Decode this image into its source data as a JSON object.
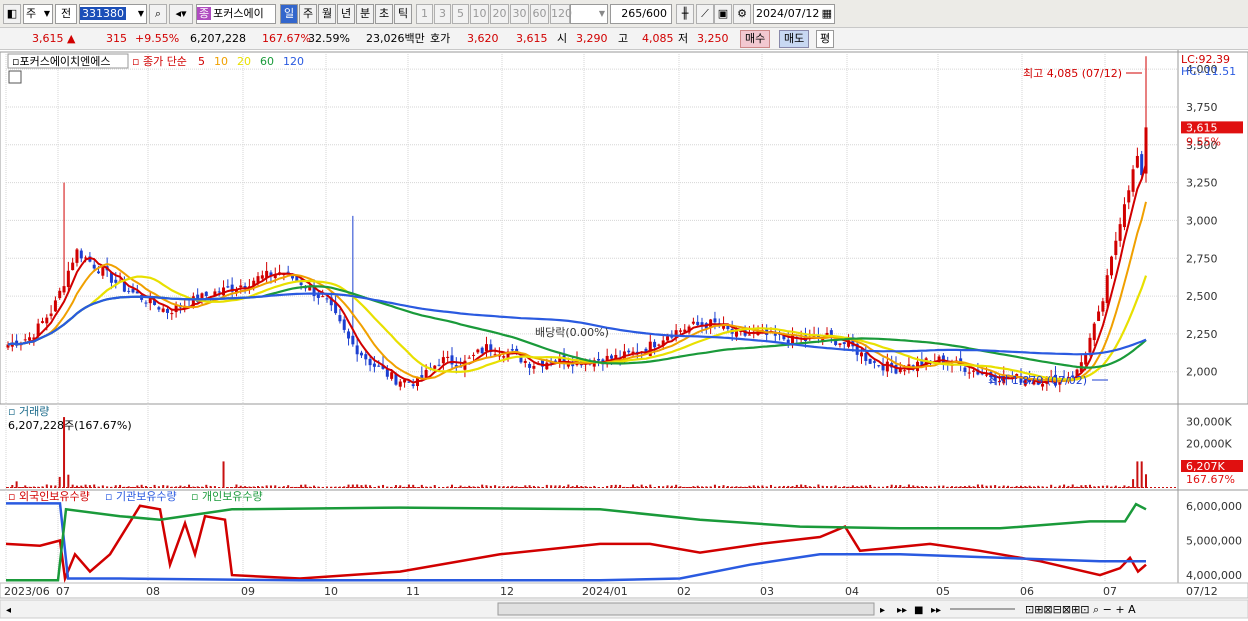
{
  "toolbar": {
    "period_mode": "주",
    "prev_label": "전",
    "code": "331380",
    "stock_name": "포커스에이",
    "intervals": [
      "일",
      "주",
      "월",
      "년",
      "분",
      "초",
      "틱"
    ],
    "active_interval": "일",
    "minutes": [
      "1",
      "3",
      "5",
      "10",
      "20",
      "30",
      "60",
      "120"
    ],
    "count": "265",
    "count_total": "/600",
    "date": "2024/07/12",
    "stock_icon_label": "종"
  },
  "quote": {
    "price": "3,615",
    "arrow": "▲",
    "change": "315",
    "change_pct": "+9.55%",
    "volume": "6,207,228",
    "volume_pct": "167.67%",
    "turnover": "32.59%",
    "amount": "23,026백만",
    "hoga_label": "호가",
    "hoga_sell": "3,620",
    "hoga_buy": "3,615",
    "open_label": "시",
    "open": "3,290",
    "high_label": "고",
    "high": "4,085",
    "low_label": "저",
    "low": "3,250",
    "buy_button": "매수",
    "sell_button": "매도",
    "eval_button": "평"
  },
  "legend": {
    "stock": "포커스에이치엔에스",
    "ma_title": "종가 단순",
    "ma": [
      {
        "label": "5",
        "color": "#d10000"
      },
      {
        "label": "10",
        "color": "#f0a000"
      },
      {
        "label": "20",
        "color": "#e8e000"
      },
      {
        "label": "60",
        "color": "#1a9a3a"
      },
      {
        "label": "120",
        "color": "#2a5ae0"
      }
    ],
    "lc": "LC:92.39",
    "hc": "HC:-11.51"
  },
  "price_axis": {
    "ticks": [
      "4,000",
      "3,750",
      "3,500",
      "3,250",
      "3,000",
      "2,750",
      "2,500",
      "2,250",
      "2,000"
    ],
    "current": "3,615",
    "current_pct": "9.55%"
  },
  "annotations": {
    "high": "최고 4,085 (07/12)",
    "low": "최저 1,879 (07/02)",
    "dividend": "배당락(0.00%)"
  },
  "volume_panel": {
    "title": "거래량",
    "info": "6,207,228주(167.67%)",
    "ticks": [
      "30,000K",
      "20,000K",
      "10,000K"
    ],
    "current": "6,207K",
    "current_pct": "167.67%"
  },
  "holding_panel": {
    "legend": [
      "외국인보유수량",
      "기관보유수량",
      "개인보유수량"
    ],
    "colors": [
      "#d10000",
      "#2a5ae0",
      "#1a9a3a"
    ],
    "ticks": [
      "6,000,000",
      "5,000,000",
      "4,000,000"
    ]
  },
  "x_axis": [
    "2023/06",
    "07",
    "08",
    "09",
    "10",
    "11",
    "12",
    "2024/01",
    "02",
    "03",
    "04",
    "05",
    "06",
    "07",
    "07/12"
  ],
  "chart_data": {
    "type": "candlestick",
    "price_range": [
      1800,
      4100
    ],
    "close_path": [
      2180,
      2230,
      2420,
      2800,
      2680,
      2560,
      2480,
      2400,
      2460,
      2520,
      2560,
      2620,
      2660,
      2580,
      2460,
      2200,
      2050,
      1950,
      1930,
      2080,
      2050,
      2160,
      2130,
      2050,
      2080,
      2070,
      2080,
      2100,
      2150,
      2250,
      2300,
      2320,
      2240,
      2250,
      2220,
      2210,
      2230,
      2170,
      2060,
      2020,
      2050,
      2080,
      2030,
      1980,
      1960,
      1950,
      1940,
      2000,
      2400,
      3100,
      3615
    ],
    "high": 4085,
    "low": 1879
  }
}
